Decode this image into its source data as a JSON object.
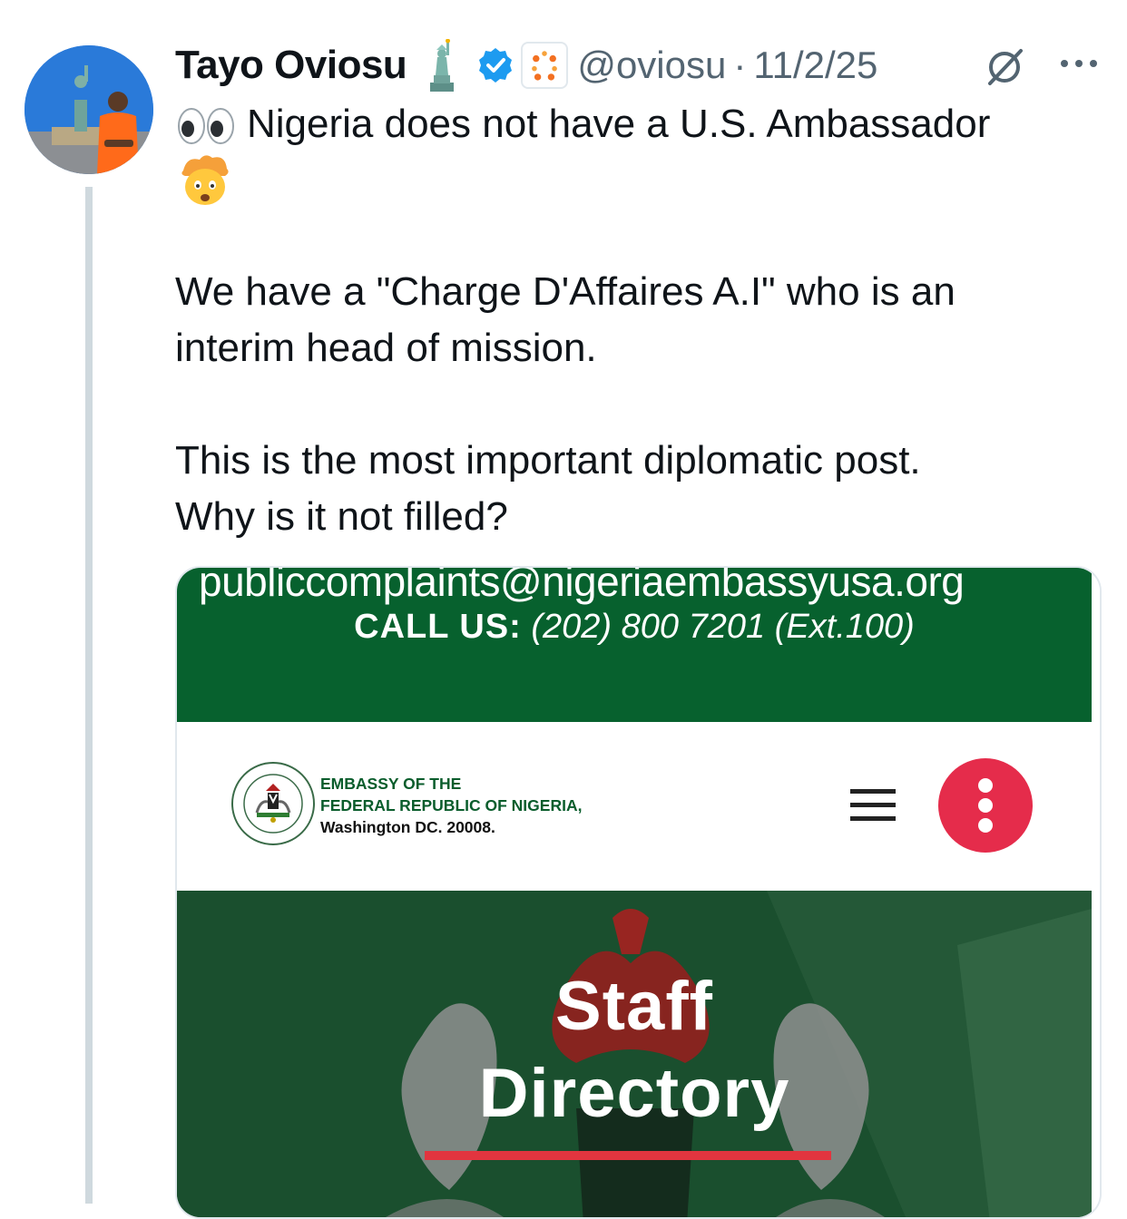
{
  "post": {
    "author_name": "Tayo Oviosu",
    "handle": "@oviosu",
    "separator": "·",
    "date": "11/2/25",
    "text_line1": "Nigeria does not have a U.S. Ambassador",
    "para2_line1": "We have a \"Charge D'Affaires A.I\" who is an",
    "para2_line2": "interim head of mission.",
    "para3_line1": "This is the most important diplomatic post.",
    "para3_line2": "Why is it not filled?"
  },
  "media": {
    "email_text": "publiccomplaints@nigeriaembassyusa.org",
    "call_label": "CALL US:",
    "call_number": "(202) 800 7201 (Ext.100)",
    "embassy_line1": "EMBASSY OF THE",
    "embassy_line2": "FEDERAL REPUBLIC OF NIGERIA,",
    "embassy_line3": "Washington DC. 20008.",
    "hero_title1": "Staff",
    "hero_title2": "Directory"
  },
  "colors": {
    "embassy_green": "#07612e",
    "hero_green": "#184d2d",
    "accent_red": "#e52c4b",
    "verified_blue": "#1d9bf0",
    "muted_text": "#536471"
  },
  "icons": {
    "liberty": "statue-of-liberty-emoji",
    "verified": "verified-badge-icon",
    "org": "affiliate-org-badge",
    "grok": "grok-icon",
    "more": "more-options-icon",
    "eyes": "eyes-emoji",
    "explode": "exploding-head-emoji",
    "menu": "hamburger-menu-icon",
    "kebab": "kebab-menu-icon"
  }
}
